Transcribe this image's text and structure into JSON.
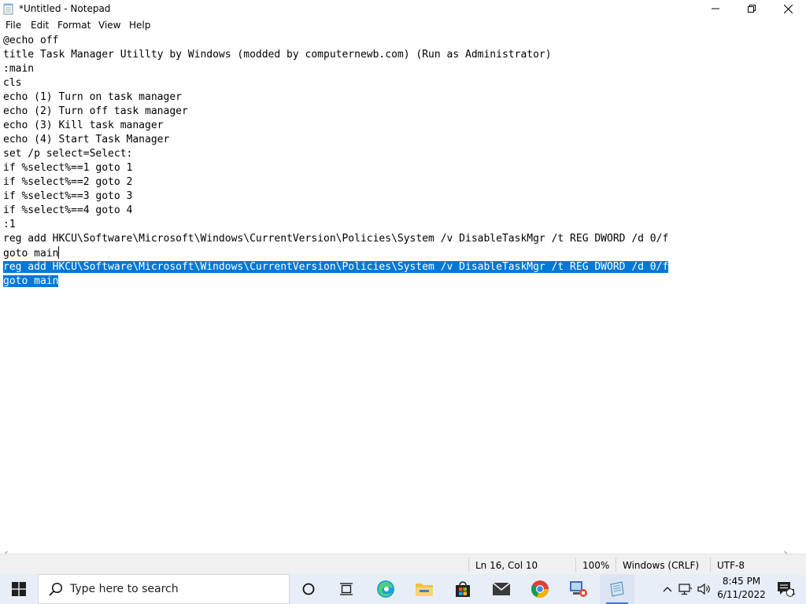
{
  "window": {
    "title": "*Untitled - Notepad"
  },
  "menu": {
    "items": [
      "File",
      "Edit",
      "Format",
      "View",
      "Help"
    ]
  },
  "editor": {
    "lines": [
      "@echo off",
      "title Task Manager Utillty by Windows (modded by computernewb.com) (Run as Administrator)",
      ":main",
      "cls",
      "echo (1) Turn on task manager",
      "echo (2) Turn off task manager",
      "echo (3) Kill task manager",
      "echo (4) Start Task Manager",
      "set /p select=Select:",
      "if %select%==1 goto 1",
      "if %select%==2 goto 2",
      "if %select%==3 goto 3",
      "if %select%==4 goto 4",
      ":1",
      "reg add HKCU\\Software\\Microsoft\\Windows\\CurrentVersion\\Policies\\System /v DisableTaskMgr /t REG DWORD /d 0/f",
      "goto main",
      "reg add HKCU\\Software\\Microsoft\\Windows\\CurrentVersion\\Policies\\System /v DisableTaskMgr /t REG DWORD /d 0/f",
      "goto main"
    ],
    "selection_color": "#0078d7"
  },
  "status": {
    "position": "Ln 16, Col 10",
    "zoom": "100%",
    "line_ending": "Windows (CRLF)",
    "encoding": "UTF-8"
  },
  "taskbar": {
    "search_placeholder": "Type here to search",
    "pinned_apps": [
      "task-view",
      "edge",
      "file-explorer",
      "microsoft-store",
      "mail",
      "chrome",
      "admin-tool",
      "notepad"
    ],
    "clock_time": "8:45 PM",
    "clock_date": "6/11/2022",
    "notification_count": "1",
    "accent": "#3a7bd5"
  }
}
